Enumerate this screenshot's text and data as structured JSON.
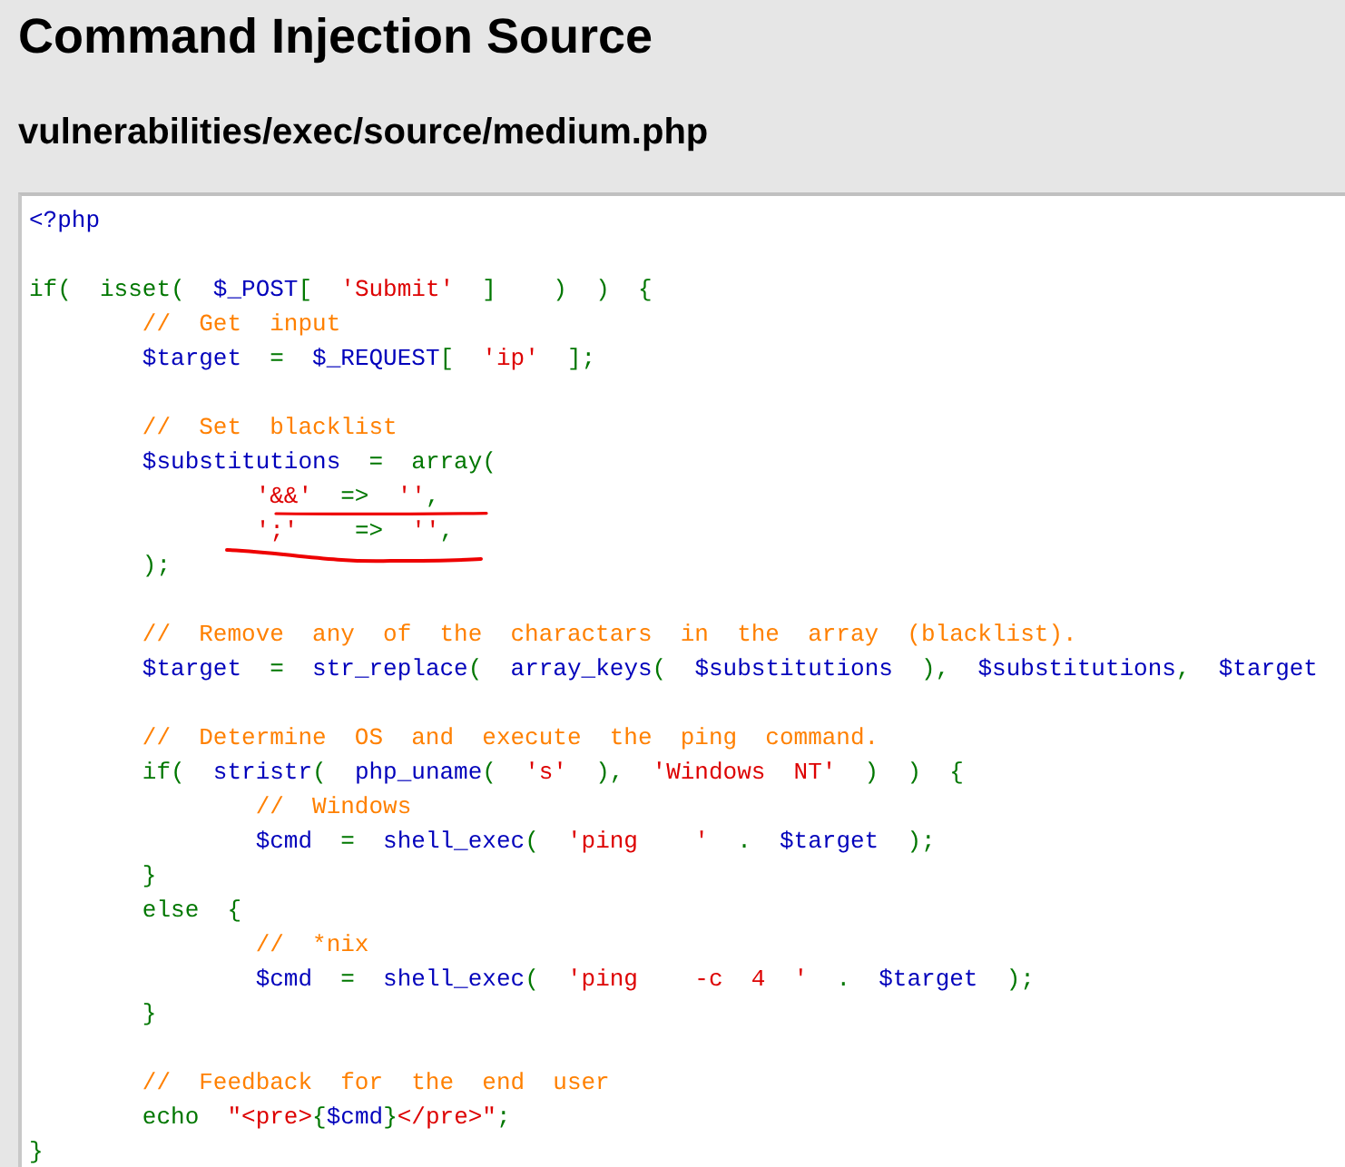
{
  "title": "Command Injection Source",
  "file_path": "vulnerabilities/exec/source/medium.php",
  "code": {
    "lines": [
      {
        "kind": "code",
        "tokens": [
          {
            "kind": "variable",
            "text": "<?php"
          }
        ]
      },
      {
        "kind": "blank"
      },
      {
        "kind": "code",
        "tokens": [
          {
            "kind": "keyword",
            "text": "if(  isset(  "
          },
          {
            "kind": "variable",
            "text": "$_POST"
          },
          {
            "kind": "keyword",
            "text": "[  "
          },
          {
            "kind": "string",
            "text": "'Submit'"
          },
          {
            "kind": "keyword",
            "text": "  ]    )  )  {"
          }
        ]
      },
      {
        "kind": "code",
        "tokens": [
          {
            "kind": "comment",
            "text": "        //  Get  input"
          }
        ]
      },
      {
        "kind": "code",
        "tokens": [
          {
            "kind": "variable",
            "text": "        $target"
          },
          {
            "kind": "keyword",
            "text": "  =  "
          },
          {
            "kind": "variable",
            "text": "$_REQUEST"
          },
          {
            "kind": "keyword",
            "text": "[  "
          },
          {
            "kind": "string",
            "text": "'ip'"
          },
          {
            "kind": "keyword",
            "text": "  ];"
          }
        ]
      },
      {
        "kind": "blank"
      },
      {
        "kind": "code",
        "tokens": [
          {
            "kind": "comment",
            "text": "        //  Set  blacklist"
          }
        ]
      },
      {
        "kind": "code",
        "tokens": [
          {
            "kind": "variable",
            "text": "        $substitutions"
          },
          {
            "kind": "keyword",
            "text": "  =  array("
          }
        ]
      },
      {
        "kind": "code",
        "tokens": [
          {
            "kind": "string",
            "text": "                '&&'"
          },
          {
            "kind": "keyword",
            "text": "  =>  "
          },
          {
            "kind": "string",
            "text": "''"
          },
          {
            "kind": "keyword",
            "text": ","
          }
        ]
      },
      {
        "kind": "code",
        "tokens": [
          {
            "kind": "string",
            "text": "                ';'"
          },
          {
            "kind": "keyword",
            "text": "    =>  "
          },
          {
            "kind": "string",
            "text": "''"
          },
          {
            "kind": "keyword",
            "text": ","
          }
        ]
      },
      {
        "kind": "code",
        "tokens": [
          {
            "kind": "keyword",
            "text": "        );"
          }
        ]
      },
      {
        "kind": "blank"
      },
      {
        "kind": "code",
        "tokens": [
          {
            "kind": "comment",
            "text": "        //  Remove  any  of  the  charactars  in  the  array  (blacklist)."
          }
        ]
      },
      {
        "kind": "code",
        "tokens": [
          {
            "kind": "variable",
            "text": "        $target"
          },
          {
            "kind": "keyword",
            "text": "  =  "
          },
          {
            "kind": "variable",
            "text": "str_replace"
          },
          {
            "kind": "keyword",
            "text": "(  "
          },
          {
            "kind": "variable",
            "text": "array_keys"
          },
          {
            "kind": "keyword",
            "text": "(  "
          },
          {
            "kind": "variable",
            "text": "$substitutions"
          },
          {
            "kind": "keyword",
            "text": "  ),  "
          },
          {
            "kind": "variable",
            "text": "$substitutions"
          },
          {
            "kind": "keyword",
            "text": ",  "
          },
          {
            "kind": "variable",
            "text": "$target"
          }
        ]
      },
      {
        "kind": "blank"
      },
      {
        "kind": "code",
        "tokens": [
          {
            "kind": "comment",
            "text": "        //  Determine  OS  and  execute  the  ping  command."
          }
        ]
      },
      {
        "kind": "code",
        "tokens": [
          {
            "kind": "keyword",
            "text": "        if(  "
          },
          {
            "kind": "variable",
            "text": "stristr"
          },
          {
            "kind": "keyword",
            "text": "(  "
          },
          {
            "kind": "variable",
            "text": "php_uname"
          },
          {
            "kind": "keyword",
            "text": "(  "
          },
          {
            "kind": "string",
            "text": "'s'"
          },
          {
            "kind": "keyword",
            "text": "  ),  "
          },
          {
            "kind": "string",
            "text": "'Windows  NT'"
          },
          {
            "kind": "keyword",
            "text": "  )  )  {"
          }
        ]
      },
      {
        "kind": "code",
        "tokens": [
          {
            "kind": "comment",
            "text": "                //  Windows"
          }
        ]
      },
      {
        "kind": "code",
        "tokens": [
          {
            "kind": "variable",
            "text": "                $cmd"
          },
          {
            "kind": "keyword",
            "text": "  =  "
          },
          {
            "kind": "variable",
            "text": "shell_exec"
          },
          {
            "kind": "keyword",
            "text": "(  "
          },
          {
            "kind": "string",
            "text": "'ping    '"
          },
          {
            "kind": "keyword",
            "text": "  .  "
          },
          {
            "kind": "variable",
            "text": "$target"
          },
          {
            "kind": "keyword",
            "text": "  );"
          }
        ]
      },
      {
        "kind": "code",
        "tokens": [
          {
            "kind": "keyword",
            "text": "        }"
          }
        ]
      },
      {
        "kind": "code",
        "tokens": [
          {
            "kind": "keyword",
            "text": "        else  {"
          }
        ]
      },
      {
        "kind": "code",
        "tokens": [
          {
            "kind": "comment",
            "text": "                //  *nix"
          }
        ]
      },
      {
        "kind": "code",
        "tokens": [
          {
            "kind": "variable",
            "text": "                $cmd"
          },
          {
            "kind": "keyword",
            "text": "  =  "
          },
          {
            "kind": "variable",
            "text": "shell_exec"
          },
          {
            "kind": "keyword",
            "text": "(  "
          },
          {
            "kind": "string",
            "text": "'ping    -c  4  '"
          },
          {
            "kind": "keyword",
            "text": "  .  "
          },
          {
            "kind": "variable",
            "text": "$target"
          },
          {
            "kind": "keyword",
            "text": "  );"
          }
        ]
      },
      {
        "kind": "code",
        "tokens": [
          {
            "kind": "keyword",
            "text": "        }"
          }
        ]
      },
      {
        "kind": "blank"
      },
      {
        "kind": "code",
        "tokens": [
          {
            "kind": "comment",
            "text": "        //  Feedback  for  the  end  user"
          }
        ]
      },
      {
        "kind": "code",
        "tokens": [
          {
            "kind": "keyword",
            "text": "        echo  "
          },
          {
            "kind": "string",
            "text": "\"<pre>"
          },
          {
            "kind": "keyword",
            "text": "{"
          },
          {
            "kind": "variable",
            "text": "$cmd"
          },
          {
            "kind": "keyword",
            "text": "}"
          },
          {
            "kind": "string",
            "text": "</pre>\""
          },
          {
            "kind": "keyword",
            "text": ";"
          }
        ]
      },
      {
        "kind": "code",
        "tokens": [
          {
            "kind": "keyword",
            "text": "}"
          }
        ]
      }
    ]
  }
}
